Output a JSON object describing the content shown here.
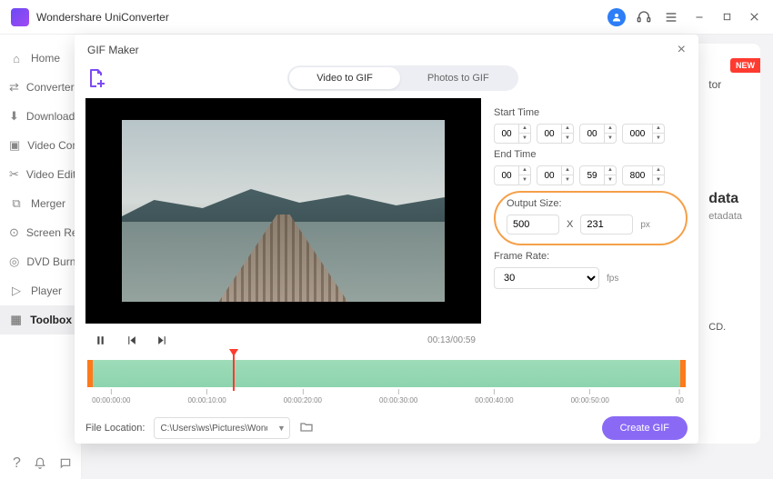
{
  "app": {
    "title": "Wondershare UniConverter"
  },
  "sidebar": {
    "items": [
      {
        "label": "Home"
      },
      {
        "label": "Converter"
      },
      {
        "label": "Downloader"
      },
      {
        "label": "Video Compressor"
      },
      {
        "label": "Video Editor"
      },
      {
        "label": "Merger"
      },
      {
        "label": "Screen Recorder"
      },
      {
        "label": "DVD Burner"
      },
      {
        "label": "Player"
      },
      {
        "label": "Toolbox"
      }
    ]
  },
  "background": {
    "new_badge": "NEW",
    "tor_fragment": "tor",
    "data_heading": "data",
    "data_sub": "etadata",
    "cd_line": "CD."
  },
  "modal": {
    "title": "GIF Maker",
    "tabs": {
      "video": "Video to GIF",
      "photos": "Photos to GIF"
    },
    "start_label": "Start Time",
    "end_label": "End Time",
    "start": {
      "h": "00",
      "m": "00",
      "s": "00",
      "ms": "000"
    },
    "end": {
      "h": "00",
      "m": "00",
      "s": "59",
      "ms": "800"
    },
    "output_label": "Output Size:",
    "output": {
      "w": "500",
      "h": "231",
      "sep": "X",
      "unit": "px"
    },
    "framerate_label": "Frame Rate:",
    "framerate": {
      "value": "30",
      "unit": "fps"
    },
    "playback": {
      "elapsed": "00:13",
      "total": "00:59"
    },
    "timeline": {
      "ticks": [
        "00:00:00:00",
        "00:00:10:00",
        "00:00:20:00",
        "00:00:30:00",
        "00:00:40:00",
        "00:00:50:00",
        "00"
      ]
    },
    "footer": {
      "label": "File Location:",
      "path": "C:\\Users\\ws\\Pictures\\Wonders",
      "create": "Create GIF"
    }
  }
}
